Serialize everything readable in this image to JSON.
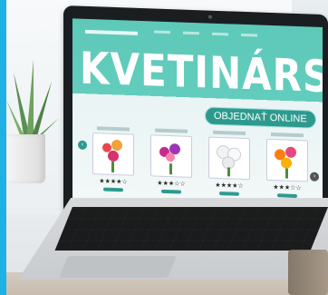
{
  "website": {
    "title": "KVETINÁRSTVO",
    "order_button": "OBJEDNAŤ ONLINE"
  },
  "products": [
    {
      "stars": "★★★★☆"
    },
    {
      "stars": "★★★☆☆"
    },
    {
      "stars": "★★★★☆"
    },
    {
      "stars": "★★★☆☆"
    }
  ],
  "carousel": {
    "prev_icon": "chevron-left-icon",
    "next_icon": "chevron-right-icon"
  },
  "colors": {
    "accent": "#2e9a8f",
    "hero": "#5ec9b8",
    "strip": "#1fb0e6"
  }
}
